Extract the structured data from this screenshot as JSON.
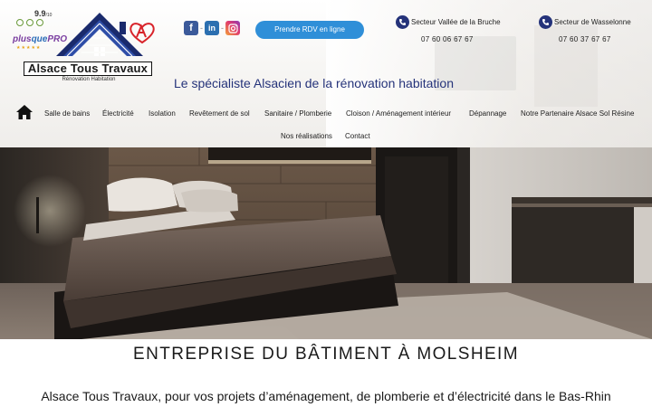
{
  "header": {
    "logo": {
      "rating_score": "9.9",
      "rating_scale": "/10",
      "rating_brand_a": "plus",
      "rating_brand_b": "que",
      "rating_brand_c": "PRO",
      "name": "Alsace Tous Travaux",
      "subtitle": "Rénovation Habitation"
    },
    "socials": [
      {
        "name": "facebook-icon",
        "glyph": "f"
      },
      {
        "name": "linkedin-icon",
        "glyph": "in"
      },
      {
        "name": "instagram-icon",
        "glyph": ""
      }
    ],
    "rdv_button": "Prendre RDV en ligne",
    "phones": [
      {
        "label": "Secteur Vallée de la Bruche",
        "number": "07 60 06 67 67"
      },
      {
        "label": "Secteur de Wasselonne",
        "number": "07 60 37 67 67"
      }
    ],
    "tagline": "Le spécialiste Alsacien de la rénovation habitation",
    "nav": {
      "home_icon": "home-icon",
      "items": [
        "Salle de bains",
        "Électricité",
        "Isolation",
        "Revêtement de sol",
        "Sanitaire / Plomberie",
        "Cloison / Aménagement intérieur",
        "Dépannage",
        "Notre Partenaire Alsace Sol Résine",
        "Nos réalisations",
        "Contact"
      ]
    }
  },
  "hero": {
    "image": "bedroom-photo"
  },
  "main": {
    "heading": "ENTREPRISE DU BÂTIMENT À MOLSHEIM",
    "subheading": "Alsace Tous Travaux, pour vos projets d’aménagement, de plomberie et d’électricité dans le Bas-Rhin"
  },
  "colors": {
    "brand_navy": "#25337a",
    "button_blue": "#2f8fd8",
    "alsace_red": "#d8232a"
  }
}
